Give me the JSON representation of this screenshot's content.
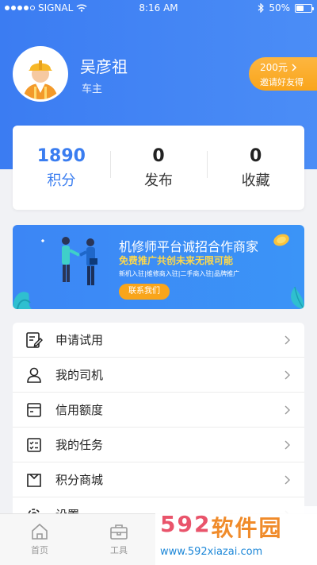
{
  "statusbar": {
    "carrier": "SIGNAL",
    "time": "8:16 AM",
    "battery": "50%",
    "battery_level": 0.5
  },
  "profile": {
    "name": "吴彦祖",
    "role": "车主"
  },
  "invite": {
    "amount": "200元",
    "text": "邀请好友得"
  },
  "stats": [
    {
      "value": "1890",
      "label": "积分"
    },
    {
      "value": "0",
      "label": "发布"
    },
    {
      "value": "0",
      "label": "收藏"
    }
  ],
  "banner": {
    "title": "机修师平台诚招合作商家",
    "subtitle": "免费推广共创未来无限可能",
    "tags": "新机入驻|维修商入驻|二手商入驻|品牌推广",
    "button": "联系我们"
  },
  "menu": [
    {
      "label": "申请试用",
      "icon": "edit-icon"
    },
    {
      "label": "我的司机",
      "icon": "person-icon"
    },
    {
      "label": "信用额度",
      "icon": "card-icon"
    },
    {
      "label": "我的任务",
      "icon": "checklist-icon"
    },
    {
      "label": "积分商城",
      "icon": "bag-icon"
    },
    {
      "label": "设置",
      "icon": "gear-icon"
    }
  ],
  "tabbar": [
    {
      "label": "首页",
      "icon": "home-icon"
    },
    {
      "label": "工具",
      "icon": "toolbox-icon"
    }
  ],
  "watermark": {
    "num": "592",
    "cn": "软件园",
    "url": "www.592xiazai.com"
  },
  "colors": {
    "primary": "#3b7cf2",
    "accent": "#f9a51b",
    "active_stat": "#3a7df0"
  }
}
